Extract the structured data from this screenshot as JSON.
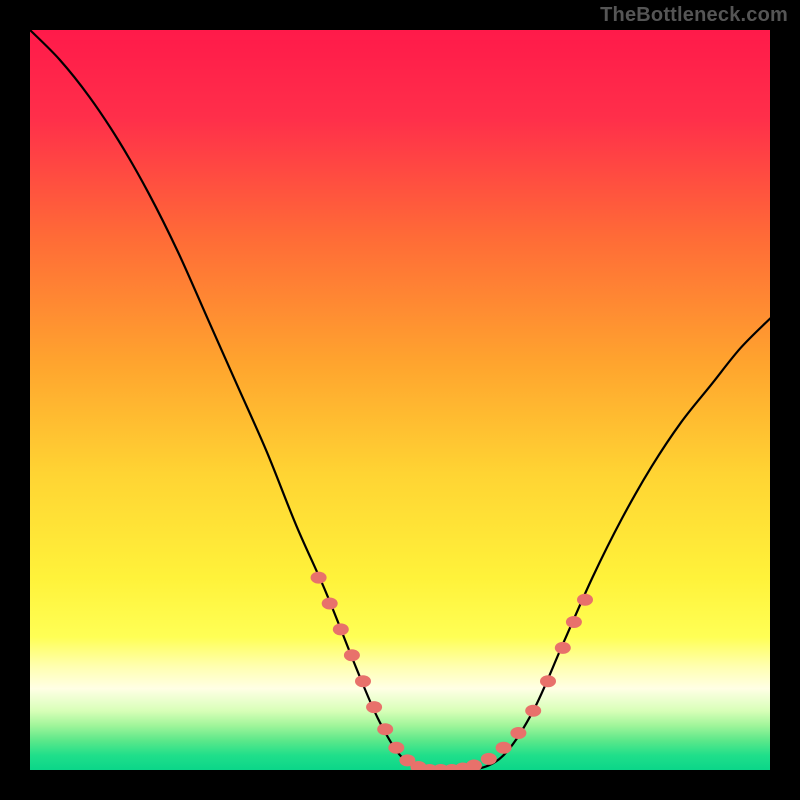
{
  "watermark": "TheBottleneck.com",
  "colors": {
    "frame": "#000000",
    "watermark": "#555555",
    "curve": "#000000",
    "marker": "#e8716b",
    "grad_stops": [
      {
        "o": 0.0,
        "c": "#ff1a4a"
      },
      {
        "o": 0.12,
        "c": "#ff2f4a"
      },
      {
        "o": 0.28,
        "c": "#ff6b37"
      },
      {
        "o": 0.45,
        "c": "#ffa42e"
      },
      {
        "o": 0.6,
        "c": "#ffd433"
      },
      {
        "o": 0.74,
        "c": "#fff23a"
      },
      {
        "o": 0.82,
        "c": "#ffff55"
      },
      {
        "o": 0.86,
        "c": "#ffffb0"
      },
      {
        "o": 0.89,
        "c": "#ffffe5"
      },
      {
        "o": 0.92,
        "c": "#d8ffb8"
      },
      {
        "o": 0.94,
        "c": "#a0f59a"
      },
      {
        "o": 0.96,
        "c": "#5ce88a"
      },
      {
        "o": 0.98,
        "c": "#20df8a"
      },
      {
        "o": 1.0,
        "c": "#0bd689"
      }
    ]
  },
  "chart_data": {
    "type": "line",
    "title": "",
    "xlabel": "",
    "ylabel": "",
    "xlim": [
      0,
      100
    ],
    "ylim": [
      0,
      100
    ],
    "x": [
      0,
      4,
      8,
      12,
      16,
      20,
      24,
      28,
      32,
      36,
      40,
      44,
      47,
      50,
      53,
      56,
      60,
      64,
      68,
      72,
      76,
      80,
      84,
      88,
      92,
      96,
      100
    ],
    "values": [
      100,
      96,
      91,
      85,
      78,
      70,
      61,
      52,
      43,
      33,
      24,
      14,
      7,
      2,
      0,
      0,
      0,
      2,
      8,
      17,
      26,
      34,
      41,
      47,
      52,
      57,
      61
    ],
    "series": [
      {
        "name": "bottleneck-curve",
        "x": [
          0,
          4,
          8,
          12,
          16,
          20,
          24,
          28,
          32,
          36,
          40,
          44,
          47,
          50,
          53,
          56,
          60,
          64,
          68,
          72,
          76,
          80,
          84,
          88,
          92,
          96,
          100
        ],
        "y": [
          100,
          96,
          91,
          85,
          78,
          70,
          61,
          52,
          43,
          33,
          24,
          14,
          7,
          2,
          0,
          0,
          0,
          2,
          8,
          17,
          26,
          34,
          41,
          47,
          52,
          57,
          61
        ]
      }
    ],
    "markers": {
      "name": "highlight-dots",
      "x": [
        39,
        40.5,
        42,
        43.5,
        45,
        46.5,
        48,
        49.5,
        51,
        52.5,
        54,
        55.5,
        57,
        58.5,
        60,
        62,
        64,
        66,
        68,
        70,
        72,
        73.5,
        75
      ],
      "y": [
        26,
        22.5,
        19,
        15.5,
        12,
        8.5,
        5.5,
        3,
        1.3,
        0.4,
        0,
        0,
        0,
        0.2,
        0.6,
        1.5,
        3,
        5,
        8,
        12,
        16.5,
        20,
        23
      ]
    }
  }
}
